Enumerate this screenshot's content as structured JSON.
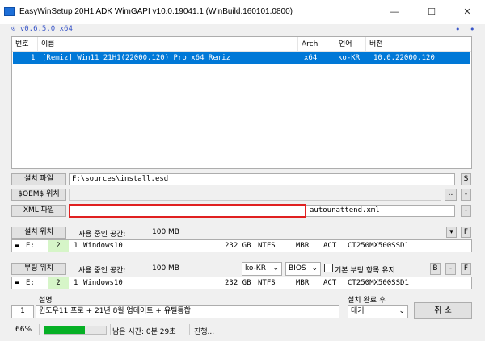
{
  "titlebar": {
    "title": "EasyWinSetup   20H1 ADK   WimGAPI v10.0.19041.1 (WinBuild.160101.0800)",
    "minimize": "—",
    "maximize": "☐",
    "close": "✕"
  },
  "version": "v0.6.5.0 x64",
  "menu_dots": "• •",
  "image_list": {
    "columns": [
      "번호",
      "이름",
      "Arch",
      "언어",
      "버전"
    ],
    "rows": [
      {
        "index": "1",
        "name": "[Remiz] Win11 21H1(22000.120) Pro x64 Remiz",
        "arch": "x64",
        "lang": "ko-KR",
        "version": "10.0.22000.120"
      }
    ]
  },
  "install_file": {
    "button": "설치 파일",
    "value": "F:\\sources\\install.esd",
    "side_button": "S"
  },
  "oem_folder": {
    "button": "$OEM$ 위치",
    "value": "",
    "browse": "..",
    "clear": "-"
  },
  "xml_file": {
    "button": "XML 파일",
    "value": "autounattend.xml",
    "clear": "-"
  },
  "install_location": {
    "button": "설치 위치",
    "used_label": "사용 중인 공간:",
    "used_value": "100 MB",
    "dropdown": "▾",
    "f_button": "F",
    "drive": {
      "letter": "E:",
      "partition": "2",
      "disk": "1",
      "label": "Windows10",
      "size": "232 GB",
      "fs": "NTFS",
      "style": "MBR",
      "state": "ACT",
      "model": "CT250MX500SSD1"
    }
  },
  "boot_location": {
    "button": "부팅 위치",
    "used_label": "사용 중인 공간:",
    "used_value": "100 MB",
    "lang_select": "ko-KR",
    "firmware_select": "BIOS",
    "keep_boot_label": "기본 부팅 항목 유지",
    "b_button": "B",
    "minus_button": "-",
    "f_button": "F",
    "drive": {
      "letter": "E:",
      "partition": "2",
      "disk": "1",
      "label": "Windows10",
      "size": "232 GB",
      "fs": "NTFS",
      "style": "MBR",
      "state": "ACT",
      "model": "CT250MX500SSD1"
    }
  },
  "description": {
    "header": "설명",
    "index": "1",
    "text": "윈도우11 프로 + 21년 8월 업데이트 + 유틸통합"
  },
  "after_install": {
    "label": "설치 완료 후",
    "value": "대기"
  },
  "cancel_button": "취 소",
  "status": {
    "percent": "66%",
    "progress": 0.66,
    "remaining": "남은 시간: 0분 29초",
    "state": "진행..."
  },
  "colors": {
    "accent": "#0078d7",
    "progress": "#06b025",
    "xml_highlight": "#e02020",
    "version_text": "#3a56c8"
  }
}
